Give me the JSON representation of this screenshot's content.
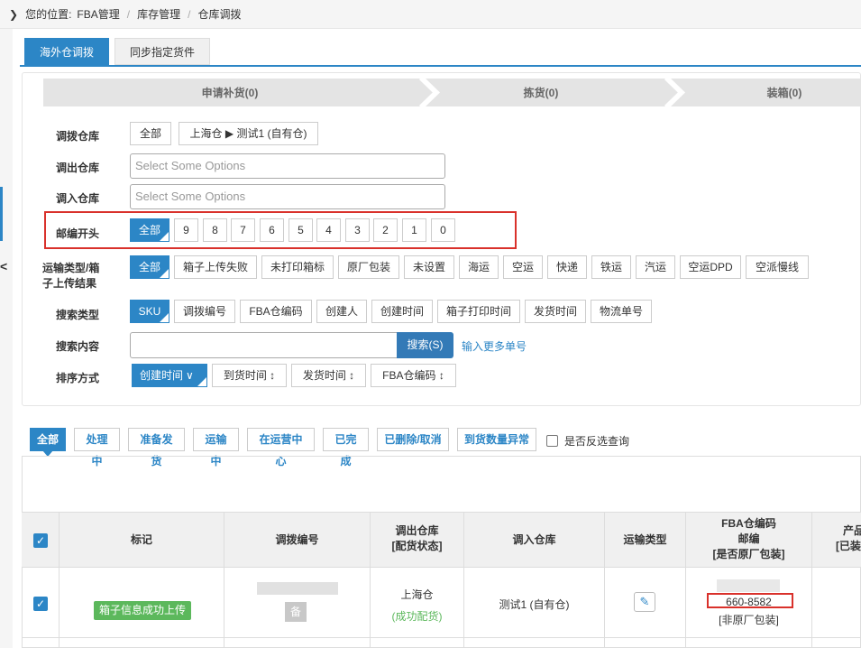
{
  "breadcrumb": {
    "prefix": "您的位置:",
    "items": [
      "FBA管理",
      "库存管理",
      "仓库调拨"
    ]
  },
  "tabs": [
    "海外仓调拨",
    "同步指定货件"
  ],
  "steps": [
    "申请补货(0)",
    "拣货(0)",
    "装箱(0)"
  ],
  "filters": {
    "warehouse": {
      "label": "调拨仓库",
      "options": [
        "全部",
        "上海仓 ▶ 测试1 (自有仓)"
      ]
    },
    "out_warehouse": {
      "label": "调出仓库",
      "placeholder": "Select Some Options"
    },
    "in_warehouse": {
      "label": "调入仓库",
      "placeholder": "Select Some Options"
    },
    "zip_prefix": {
      "label": "邮编开头",
      "options": [
        "全部",
        "9",
        "8",
        "7",
        "6",
        "5",
        "4",
        "3",
        "2",
        "1",
        "0"
      ]
    },
    "transport": {
      "label_line1": "运输类型/箱",
      "label_line2": "子上传结果",
      "options": [
        "全部",
        "箱子上传失败",
        "未打印箱标",
        "原厂包装",
        "未设置",
        "海运",
        "空运",
        "快递",
        "铁运",
        "汽运",
        "空运DPD",
        "空派慢线"
      ]
    },
    "search_type": {
      "label": "搜索类型",
      "options": [
        "SKU",
        "调拨编号",
        "FBA仓编码",
        "创建人",
        "创建时间",
        "箱子打印时间",
        "发货时间",
        "物流单号"
      ]
    },
    "search_content": {
      "label": "搜索内容",
      "value": "",
      "button": "搜索(S)",
      "more": "输入更多单号"
    },
    "sort": {
      "label": "排序方式",
      "options": [
        "创建时间",
        "到货时间",
        "发货时间",
        "FBA仓编码"
      ]
    }
  },
  "status_tabs": [
    "全部",
    "处理中",
    "准备发货",
    "运输中",
    "在运营中心",
    "已完成",
    "已删除/取消",
    "到货数量异常"
  ],
  "reverse_query": "是否反选查询",
  "table": {
    "headers": {
      "mark": "标记",
      "transfer_no": "调拨编号",
      "out_wh_line1": "调出仓库",
      "out_wh_line2": "[配货状态]",
      "in_wh": "调入仓库",
      "transport": "运输类型",
      "fba_line1": "FBA仓编码",
      "fba_line2": "邮编",
      "fba_line3": "[是否原厂包装]",
      "product_line1": "产品",
      "product_line2": "[已装"
    },
    "rows": [
      {
        "mark": "箱子信息成功上传",
        "transfer_badge": "备",
        "out_wh": "上海仓",
        "out_status": "(成功配货)",
        "in_wh": "测试1 (自有仓)",
        "zip": "660-8582",
        "packaging": "[非原厂包装]"
      }
    ]
  },
  "colors": {
    "primary": "#2c86c6",
    "success": "#5cb85c",
    "highlight": "#d9312b"
  }
}
